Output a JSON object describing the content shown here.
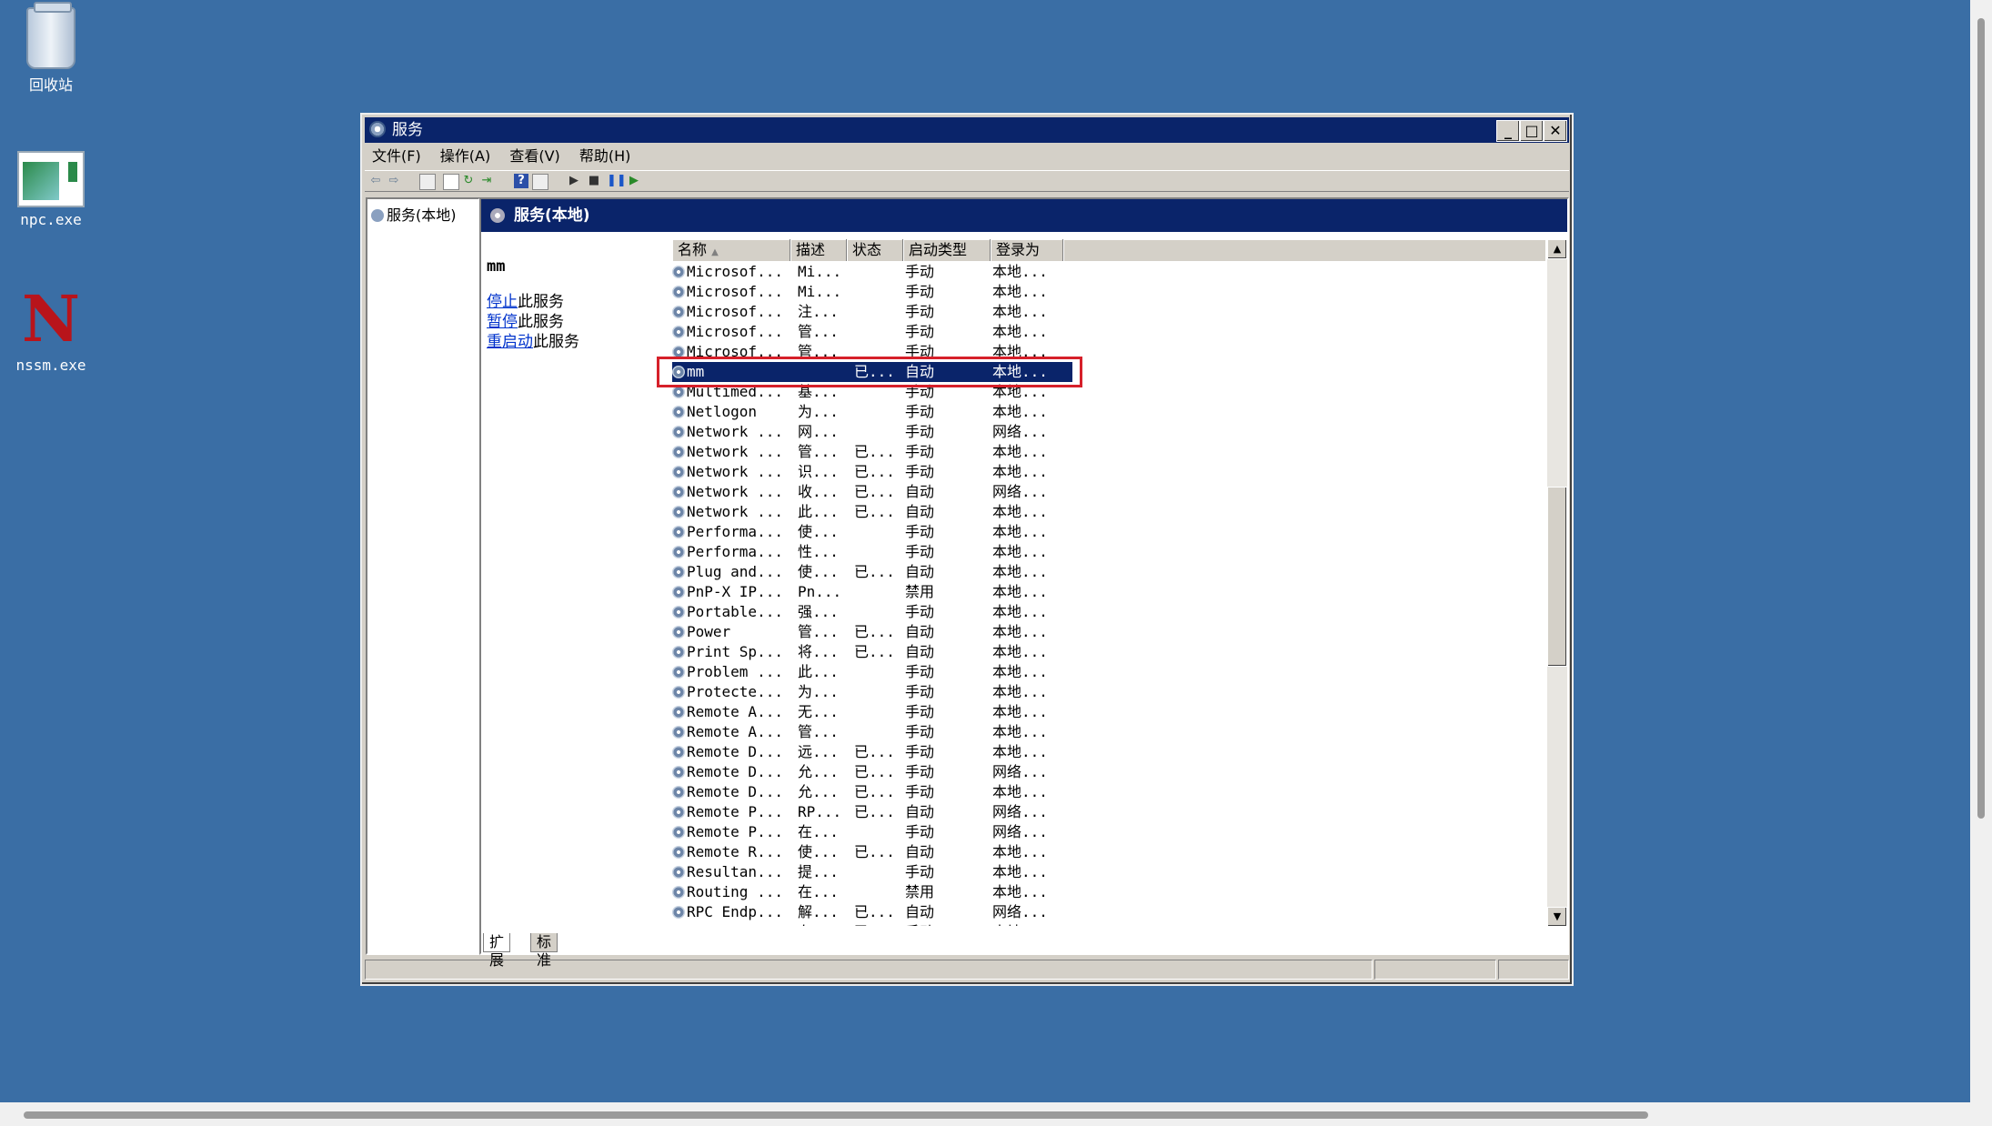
{
  "desktop": {
    "icons": [
      {
        "label": "回收站",
        "icon": "recycle-bin-icon"
      },
      {
        "label": "npc.exe",
        "icon": "app-window-icon"
      },
      {
        "label": "nssm.exe",
        "icon": "nssm-logo-icon",
        "glyph": "N"
      }
    ]
  },
  "window": {
    "title": "服务",
    "buttons": {
      "minimize": "_",
      "maximize": "□",
      "close": "✕"
    },
    "menu": [
      "文件(F)",
      "操作(A)",
      "查看(V)",
      "帮助(H)"
    ],
    "toolbar_icons": [
      "back-icon",
      "forward-icon",
      "console-tree-icon",
      "properties-icon",
      "refresh-icon",
      "export-icon",
      "help-icon",
      "view-icon",
      "start-icon",
      "stop-icon",
      "pause-icon",
      "restart-icon"
    ],
    "tree": {
      "root": "服务(本地)"
    },
    "pane_header": "服务(本地)",
    "extended": {
      "selected_service": "mm",
      "links": [
        {
          "link": "停止",
          "rest": "此服务"
        },
        {
          "link": "暂停",
          "rest": "此服务"
        },
        {
          "link": "重启动",
          "rest": "此服务"
        }
      ]
    },
    "columns": [
      "名称",
      "描述",
      "状态",
      "启动类型",
      "登录为"
    ],
    "sort_indicator": "▲",
    "rows": [
      [
        "Microsof...",
        "Mi...",
        "",
        "手动",
        "本地..."
      ],
      [
        "Microsof...",
        "Mi...",
        "",
        "手动",
        "本地..."
      ],
      [
        "Microsof...",
        "注...",
        "",
        "手动",
        "本地..."
      ],
      [
        "Microsof...",
        "管...",
        "",
        "手动",
        "本地..."
      ],
      [
        "Microsof...",
        "管...",
        "",
        "手动",
        "本地..."
      ],
      [
        "mm",
        "",
        "已...",
        "自动",
        "本地..."
      ],
      [
        "Multimed...",
        "基...",
        "",
        "手动",
        "本地..."
      ],
      [
        "Netlogon",
        "为...",
        "",
        "手动",
        "本地..."
      ],
      [
        "Network ...",
        "网...",
        "",
        "手动",
        "网络..."
      ],
      [
        "Network ...",
        "管...",
        "已...",
        "手动",
        "本地..."
      ],
      [
        "Network ...",
        "识...",
        "已...",
        "手动",
        "本地..."
      ],
      [
        "Network ...",
        "收...",
        "已...",
        "自动",
        "网络..."
      ],
      [
        "Network ...",
        "此...",
        "已...",
        "自动",
        "本地..."
      ],
      [
        "Performa...",
        "使...",
        "",
        "手动",
        "本地..."
      ],
      [
        "Performa...",
        "性...",
        "",
        "手动",
        "本地..."
      ],
      [
        "Plug and...",
        "使...",
        "已...",
        "自动",
        "本地..."
      ],
      [
        "PnP-X IP...",
        "Pn...",
        "",
        "禁用",
        "本地..."
      ],
      [
        "Portable...",
        "强...",
        "",
        "手动",
        "本地..."
      ],
      [
        "Power",
        "管...",
        "已...",
        "自动",
        "本地..."
      ],
      [
        "Print Sp...",
        "将...",
        "已...",
        "自动",
        "本地..."
      ],
      [
        "Problem ...",
        "此...",
        "",
        "手动",
        "本地..."
      ],
      [
        "Protecte...",
        "为...",
        "",
        "手动",
        "本地..."
      ],
      [
        "Remote A...",
        "无...",
        "",
        "手动",
        "本地..."
      ],
      [
        "Remote A...",
        "管...",
        "",
        "手动",
        "本地..."
      ],
      [
        "Remote D...",
        "远...",
        "已...",
        "手动",
        "本地..."
      ],
      [
        "Remote D...",
        "允...",
        "已...",
        "手动",
        "网络..."
      ],
      [
        "Remote D...",
        "允...",
        "已...",
        "手动",
        "本地..."
      ],
      [
        "Remote P...",
        "RP...",
        "已...",
        "自动",
        "网络..."
      ],
      [
        "Remote P...",
        "在...",
        "",
        "手动",
        "网络..."
      ],
      [
        "Remote R...",
        "使...",
        "已...",
        "自动",
        "本地..."
      ],
      [
        "Resultan...",
        "提...",
        "",
        "手动",
        "本地..."
      ],
      [
        "Routing ...",
        "在...",
        "",
        "禁用",
        "本地..."
      ],
      [
        "RPC Endp...",
        "解...",
        "已...",
        "自动",
        "网络..."
      ],
      [
        "Secondar...",
        "在...",
        "已...",
        "手动",
        "本地..."
      ]
    ],
    "selected_row": 5,
    "tabs": [
      "扩展",
      "标准"
    ],
    "highlight_color": "#d6202a"
  }
}
